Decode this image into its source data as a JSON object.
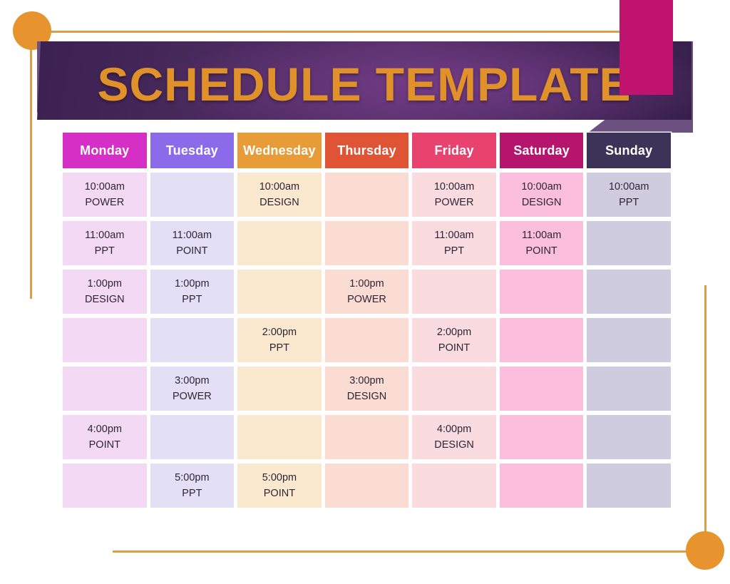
{
  "title": "SCHEDULE TEMPLATE",
  "theme": {
    "banner_dark": "#3b2150",
    "banner_light": "#6b5080",
    "title_color": "#e1912a",
    "accent_bar": "#bf136f",
    "deco_line": "#d9a04a",
    "deco_circle": "#e8942e",
    "page_background": "#ffffff"
  },
  "columns": [
    {
      "label": "Monday",
      "header_color": "#d62fc6",
      "cell_color": "#f3d9f4"
    },
    {
      "label": "Tuesday",
      "header_color": "#8c6beb",
      "cell_color": "#e3e0f6"
    },
    {
      "label": "Wednesday",
      "header_color": "#e89c38",
      "cell_color": "#fae8cf"
    },
    {
      "label": "Thursday",
      "header_color": "#df5434",
      "cell_color": "#fadcd2"
    },
    {
      "label": "Friday",
      "header_color": "#e8426e",
      "cell_color": "#fadbe0"
    },
    {
      "label": "Saturday",
      "header_color": "#b5156d",
      "cell_color": "#fbbfdd"
    },
    {
      "label": "Sunday",
      "header_color": "#3b3358",
      "cell_color": "#cfccdf"
    }
  ],
  "rows": [
    [
      {
        "time": "10:00am",
        "task": "POWER"
      },
      {
        "time": "",
        "task": ""
      },
      {
        "time": "10:00am",
        "task": "DESIGN"
      },
      {
        "time": "",
        "task": ""
      },
      {
        "time": "10:00am",
        "task": "POWER"
      },
      {
        "time": "10:00am",
        "task": "DESIGN"
      },
      {
        "time": "10:00am",
        "task": "PPT"
      }
    ],
    [
      {
        "time": "11:00am",
        "task": "PPT"
      },
      {
        "time": "11:00am",
        "task": "POINT"
      },
      {
        "time": "",
        "task": ""
      },
      {
        "time": "",
        "task": ""
      },
      {
        "time": "11:00am",
        "task": "PPT"
      },
      {
        "time": "11:00am",
        "task": "POINT"
      },
      {
        "time": "",
        "task": ""
      }
    ],
    [
      {
        "time": "1:00pm",
        "task": "DESIGN"
      },
      {
        "time": "1:00pm",
        "task": "PPT"
      },
      {
        "time": "",
        "task": ""
      },
      {
        "time": "1:00pm",
        "task": "POWER"
      },
      {
        "time": "",
        "task": ""
      },
      {
        "time": "",
        "task": ""
      },
      {
        "time": "",
        "task": ""
      }
    ],
    [
      {
        "time": "",
        "task": ""
      },
      {
        "time": "",
        "task": ""
      },
      {
        "time": "2:00pm",
        "task": "PPT"
      },
      {
        "time": "",
        "task": ""
      },
      {
        "time": "2:00pm",
        "task": "POINT"
      },
      {
        "time": "",
        "task": ""
      },
      {
        "time": "",
        "task": ""
      }
    ],
    [
      {
        "time": "",
        "task": ""
      },
      {
        "time": "3:00pm",
        "task": "POWER"
      },
      {
        "time": "",
        "task": ""
      },
      {
        "time": "3:00pm",
        "task": "DESIGN"
      },
      {
        "time": "",
        "task": ""
      },
      {
        "time": "",
        "task": ""
      },
      {
        "time": "",
        "task": ""
      }
    ],
    [
      {
        "time": "4:00pm",
        "task": "POINT"
      },
      {
        "time": "",
        "task": ""
      },
      {
        "time": "",
        "task": ""
      },
      {
        "time": "",
        "task": ""
      },
      {
        "time": "4:00pm",
        "task": "DESIGN"
      },
      {
        "time": "",
        "task": ""
      },
      {
        "time": "",
        "task": ""
      }
    ],
    [
      {
        "time": "",
        "task": ""
      },
      {
        "time": "5:00pm",
        "task": "PPT"
      },
      {
        "time": "5:00pm",
        "task": "POINT"
      },
      {
        "time": "",
        "task": ""
      },
      {
        "time": "",
        "task": ""
      },
      {
        "time": "",
        "task": ""
      },
      {
        "time": "",
        "task": ""
      }
    ]
  ]
}
